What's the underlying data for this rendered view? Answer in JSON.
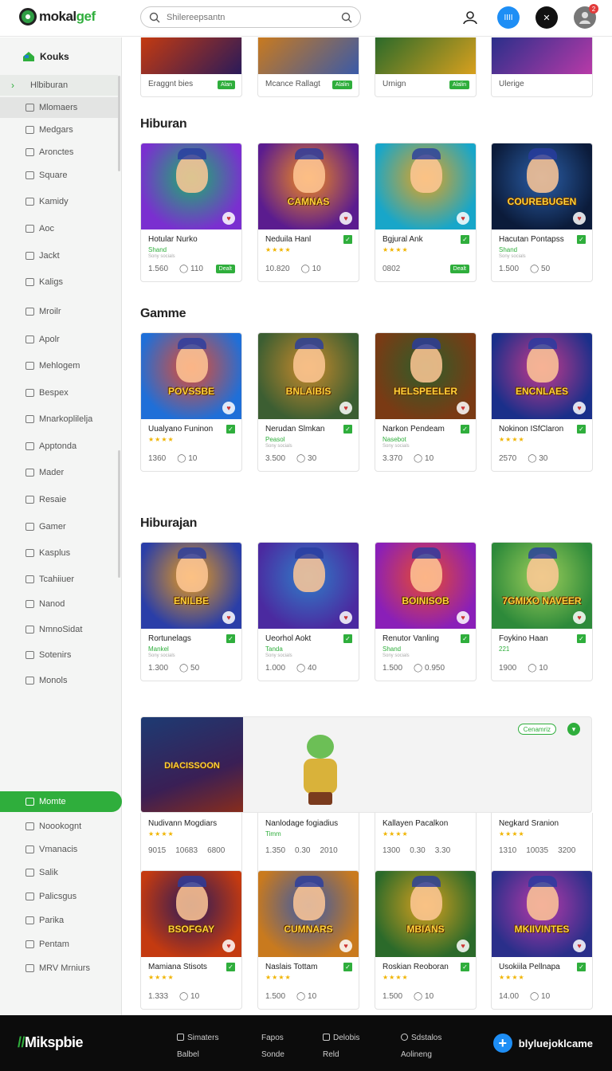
{
  "header": {
    "logo_prefix": "mokal",
    "logo_accent": "gef",
    "search_placeholder": "Shilereepsantn",
    "avatar_blue": "IIII",
    "avatar_dark": "✕",
    "notif_count": "2"
  },
  "sidebar": {
    "home_label": "Kouks",
    "items": [
      {
        "label": "Hlbiburan"
      },
      {
        "label": "Mlomaers"
      },
      {
        "label": "Medgars"
      },
      {
        "label": "Aronctes"
      },
      {
        "label": "Square"
      },
      {
        "label": "Kamidy"
      },
      {
        "label": "Aoc"
      },
      {
        "label": "Jackt"
      },
      {
        "label": "Kaligs"
      },
      {
        "label": "Mroilr"
      },
      {
        "label": "Apolr"
      },
      {
        "label": "Mehlogem"
      },
      {
        "label": "Bespex"
      },
      {
        "label": "Mnarkoplilelja"
      },
      {
        "label": "Apptonda"
      },
      {
        "label": "Mader"
      },
      {
        "label": "Resaie"
      },
      {
        "label": "Gamer"
      },
      {
        "label": "Kasplus"
      },
      {
        "label": "Tcahiiuer"
      },
      {
        "label": "Nanod"
      },
      {
        "label": "NmnoSidat"
      },
      {
        "label": "Sotenirs"
      },
      {
        "label": "Monols"
      },
      {
        "label": "Momte"
      },
      {
        "label": "Noookognt"
      },
      {
        "label": "Vmanacis"
      },
      {
        "label": "Salik"
      },
      {
        "label": "Palicsgus"
      },
      {
        "label": "Parika"
      },
      {
        "label": "Pentam"
      },
      {
        "label": "MRV Mrniurs"
      }
    ]
  },
  "top_row": [
    {
      "title": "Eraggnt bies",
      "play": "Alan"
    },
    {
      "title": "Mcance Rallagt",
      "play": "Alalin"
    },
    {
      "title": "Urnign",
      "play": "Alalin"
    },
    {
      "title": "Ulerige",
      "play": ""
    }
  ],
  "sections": [
    {
      "title": "Hiburan",
      "cards": [
        {
          "title": "Hotular Nurko",
          "sub": "Shand",
          "mini": "Sony socials",
          "stat1": "1.560",
          "stat2": "110",
          "play": "Dealt",
          "thumb_text": "",
          "check": false
        },
        {
          "title": "Neduila Hanl",
          "sub": "★★★★",
          "mini": "",
          "stat1": "10.820",
          "stat2": "10",
          "play": "",
          "thumb_text": "CAMNAS",
          "check": true
        },
        {
          "title": "Bgjural Ank",
          "sub": "★★★★",
          "mini": "",
          "stat1": "0802",
          "stat2": "",
          "play": "Dealt",
          "thumb_text": "",
          "check": true
        },
        {
          "title": "Hacutan Pontapss",
          "sub": "Shand",
          "mini": "Sony socials",
          "stat1": "1.500",
          "stat2": "50",
          "play": "",
          "thumb_text": "COUREBUGEN",
          "check": true
        }
      ]
    },
    {
      "title": "Gamme",
      "cards": [
        {
          "title": "Uualyano Funinon",
          "sub": "★★★★",
          "mini": "",
          "stat1": "1360",
          "stat2": "10",
          "play": "",
          "thumb_text": "POVSSBE",
          "check": true
        },
        {
          "title": "Nerudan Slmkan",
          "sub": "Peasol",
          "mini": "Sony socials",
          "stat1": "3.500",
          "stat2": "30",
          "play": "",
          "thumb_text": "BNLAIBIS",
          "check": true
        },
        {
          "title": "Narkon Pendeam",
          "sub": "Nasebot",
          "mini": "Sony socials",
          "stat1": "3.370",
          "stat2": "10",
          "play": "",
          "thumb_text": "HELSPEELER",
          "check": true
        },
        {
          "title": "Nokinon ISfClaron",
          "sub": "★★★★",
          "mini": "",
          "stat1": "2570",
          "stat2": "30",
          "play": "",
          "thumb_text": "ENCNLAES",
          "check": true
        }
      ]
    },
    {
      "title": "Hiburajan",
      "cards": [
        {
          "title": "Rortunelags",
          "sub": "Mankel",
          "mini": "Sony socials",
          "stat1": "1.300",
          "stat2": "50",
          "play": "",
          "thumb_text": "ENILBE",
          "check": true
        },
        {
          "title": "Ueorhol Aokt",
          "sub": "Tanda",
          "mini": "Sony socials",
          "stat1": "1.000",
          "stat2": "40",
          "play": "",
          "thumb_text": "",
          "check": true
        },
        {
          "title": "Renutor Vanling",
          "sub": "Shand",
          "mini": "Sony socials",
          "stat1": "1.500",
          "stat2": "0.950",
          "play": "",
          "thumb_text": "BOINISOB",
          "check": true
        },
        {
          "title": "Foykino Haan",
          "sub": "221",
          "mini": "",
          "stat1": "1900",
          "stat2": "10",
          "play": "",
          "thumb_text": "7GMIXO NAVEER",
          "check": true
        }
      ]
    }
  ],
  "featured": {
    "thumb_text": "DIACISSOON",
    "pill": "Cenamriz",
    "cards": [
      {
        "title": "Nudivann Mogdiars",
        "sub": "★★★★",
        "stat1": "9015",
        "stat2": "10683",
        "stat3": "6800"
      },
      {
        "title": "Nanlodage fogiadius",
        "sub": "Timm",
        "stat1": "1.350",
        "stat2": "0.30",
        "stat3": "2010"
      },
      {
        "title": "Kallayen Pacalkon",
        "sub": "★★★★",
        "stat1": "1300",
        "stat2": "0.30",
        "stat3": "3.30"
      },
      {
        "title": "Negkard Sranion",
        "sub": "★★★★",
        "stat1": "1310",
        "stat2": "10035",
        "stat3": "3200"
      }
    ]
  },
  "bottom_row": [
    {
      "title": "Mamiana Stisots",
      "sub": "★★★★",
      "stat1": "1.333",
      "stat2": "10",
      "thumb_text": "BSOFGAY"
    },
    {
      "title": "Naslais Tottam",
      "sub": "★★★★",
      "stat1": "1.500",
      "stat2": "10",
      "thumb_text": "CUMNARS"
    },
    {
      "title": "Roskian Reoboran",
      "sub": "★★★★",
      "stat1": "1.500",
      "stat2": "10",
      "thumb_text": "MBIANS"
    },
    {
      "title": "Usokiila Pellnapa",
      "sub": "★★★★",
      "stat1": "14.00",
      "stat2": "10",
      "thumb_text": "MKIIVINTES"
    }
  ],
  "footer": {
    "logo_mark": "//",
    "logo_text": "Mikspbie",
    "col1": [
      "Simaters",
      "Balbel"
    ],
    "col2": [
      "Fapos",
      "Sonde"
    ],
    "col3": [
      "Delobis",
      "Reld"
    ],
    "col4": [
      "Sdstalos",
      "Aolineng"
    ],
    "cta": "blyluejoklcame"
  },
  "colors": {
    "accent": "#2fae3c",
    "blue": "#1e8ef5",
    "footer_bg": "#0c0c0c"
  }
}
